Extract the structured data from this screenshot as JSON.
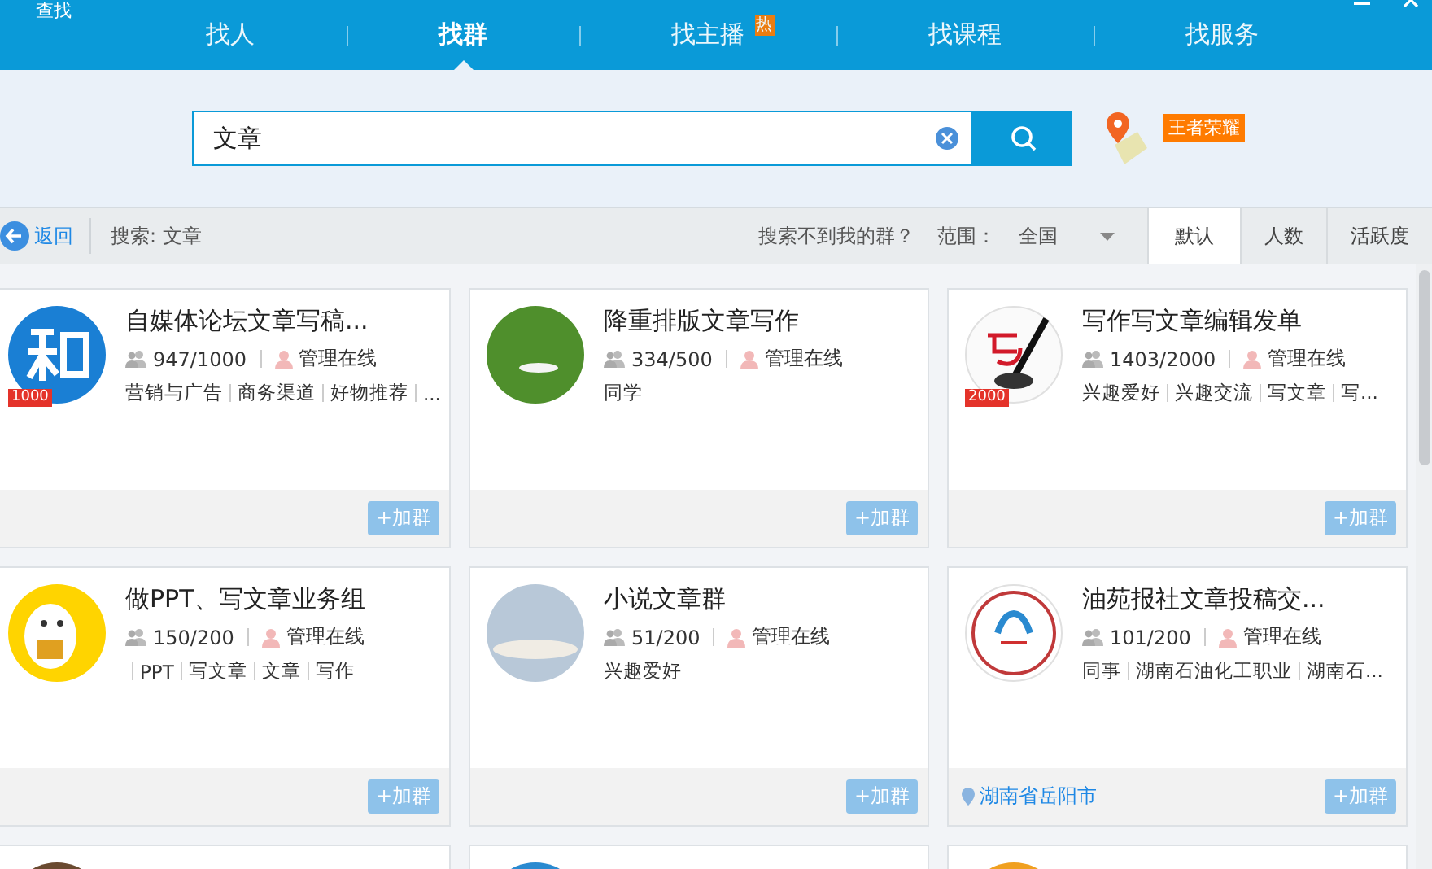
{
  "window": {
    "title": "查找"
  },
  "nav_tabs": [
    {
      "label": "找人",
      "selected": false
    },
    {
      "label": "找群",
      "selected": true
    },
    {
      "label": "找主播",
      "selected": false,
      "badge": "热"
    },
    {
      "label": "找课程",
      "selected": false
    },
    {
      "label": "找服务",
      "selected": false
    }
  ],
  "search": {
    "value": "文章",
    "tag": "王者荣耀"
  },
  "filter_bar": {
    "back": "返回",
    "query": "搜索: 文章",
    "help": "搜索不到我的群？",
    "scope_label": "范围：",
    "scope": "全国",
    "sorts": [
      {
        "label": "默认",
        "selected": true
      },
      {
        "label": "人数",
        "selected": false
      },
      {
        "label": "活跃度",
        "selected": false
      }
    ]
  },
  "groups": [
    {
      "kind": "zhi",
      "title": "自媒体论坛文章写稿...",
      "members": "947/1000",
      "admin": "管理在线",
      "tags": [
        "营销与广告",
        "商务渠道",
        "好物推荐",
        "..."
      ],
      "leading_divider": false,
      "level_badge": "1000",
      "join": "+加群"
    },
    {
      "kind": "grass",
      "title": "降重排版文章写作",
      "members": "334/500",
      "admin": "管理在线",
      "tags": [
        "同学"
      ],
      "leading_divider": false,
      "join": "+加群"
    },
    {
      "kind": "brush",
      "title": "写作写文章编辑发单",
      "members": "1403/2000",
      "admin": "管理在线",
      "tags": [
        "兴趣爱好",
        "兴趣交流",
        "写文章",
        "写..."
      ],
      "leading_divider": false,
      "level_badge": "2000",
      "join": "+加群"
    },
    {
      "kind": "cartoon",
      "title": "做PPT、写文章业务组",
      "members": "150/200",
      "admin": "管理在线",
      "tags": [
        "PPT",
        "写文章",
        "文章",
        "写作"
      ],
      "leading_divider": true,
      "join": "+加群"
    },
    {
      "kind": "sky",
      "title": "小说文章群",
      "members": "51/200",
      "admin": "管理在线",
      "tags": [
        "兴趣爱好"
      ],
      "leading_divider": false,
      "join": "+加群"
    },
    {
      "kind": "emblem",
      "title": "油苑报社文章投稿交...",
      "members": "101/200",
      "admin": "管理在线",
      "tags": [
        "同事",
        "湖南石油化工职业",
        "湖南石..."
      ],
      "leading_divider": false,
      "location": "湖南省岳阳市",
      "join": "+加群"
    }
  ],
  "more_cards": [
    {
      "kind": "brown"
    },
    {
      "kind": "blue"
    },
    {
      "kind": "orange"
    }
  ]
}
